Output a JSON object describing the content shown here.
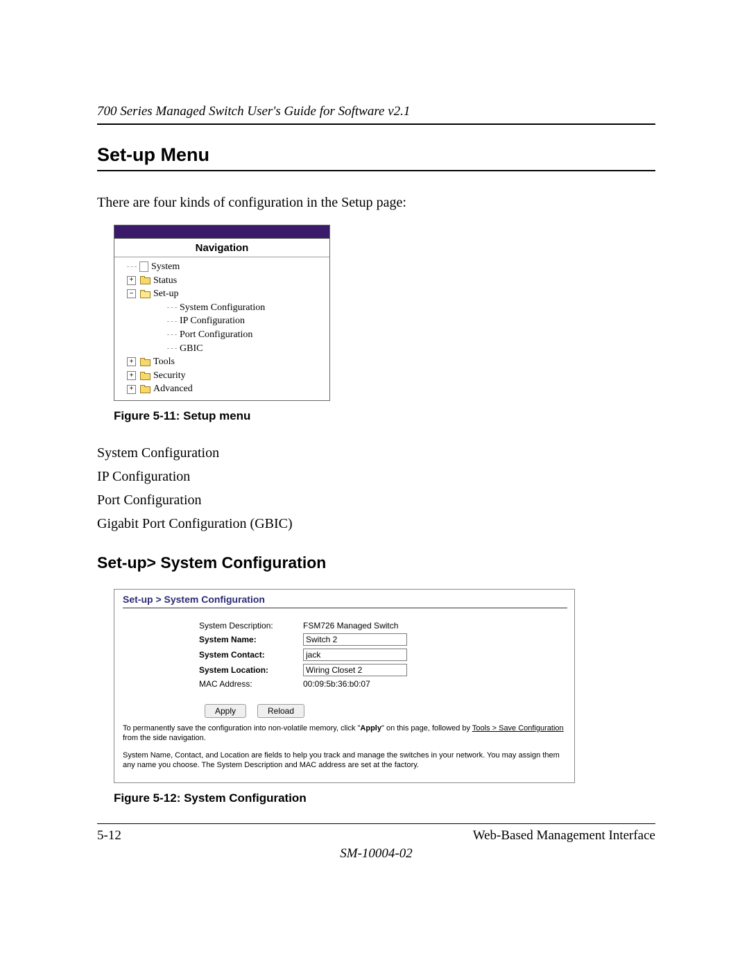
{
  "header": {
    "title": "700 Series Managed Switch User's Guide for Software v2.1"
  },
  "section1": {
    "title": "Set-up Menu",
    "intro": "There are four kinds of configuration in the Setup page:",
    "fig_caption": "Figure 5-11:  Setup menu",
    "config_items": {
      "a": "System Configuration",
      "b": "IP Configuration",
      "c": "Port Configuration",
      "d": "Gigabit Port Configuration (GBIC)"
    }
  },
  "nav": {
    "heading": "Navigation",
    "items": {
      "system": "System",
      "status": "Status",
      "setup": "Set-up",
      "sysconf": "System Configuration",
      "ipconf": "IP Configuration",
      "portconf": "Port Configuration",
      "gbic": "GBIC",
      "tools": "Tools",
      "security": "Security",
      "advanced": "Advanced"
    }
  },
  "section2": {
    "title": "Set-up> System Configuration",
    "fig_caption": "Figure 5-12:  System Configuration"
  },
  "sysconf": {
    "panel_title": "Set-up > System Configuration",
    "labels": {
      "desc": "System Description:",
      "name": "System Name:",
      "contact": "System Contact:",
      "location": "System Location:",
      "mac": "MAC Address:"
    },
    "values": {
      "desc": "FSM726 Managed Switch",
      "name": "Switch 2",
      "contact": "jack",
      "location": "Wiring Closet 2",
      "mac": "00:09:5b:36:b0:07"
    },
    "buttons": {
      "apply": "Apply",
      "reload": "Reload"
    },
    "note1_a": "To permanently save the configuration into non-volatile memory, click \"",
    "note1_b": "Apply",
    "note1_c": "\" on this page, followed by ",
    "note1_d": "Tools > Save Configuration",
    "note1_e": " from the side navigation.",
    "note2": "System Name, Contact, and Location are fields to help you track and manage the switches in your network. You may assign them any name you choose. The System Description and MAC address are set at the factory."
  },
  "footer": {
    "left": "5-12",
    "right": "Web-Based Management Interface",
    "code": "SM-10004-02"
  }
}
